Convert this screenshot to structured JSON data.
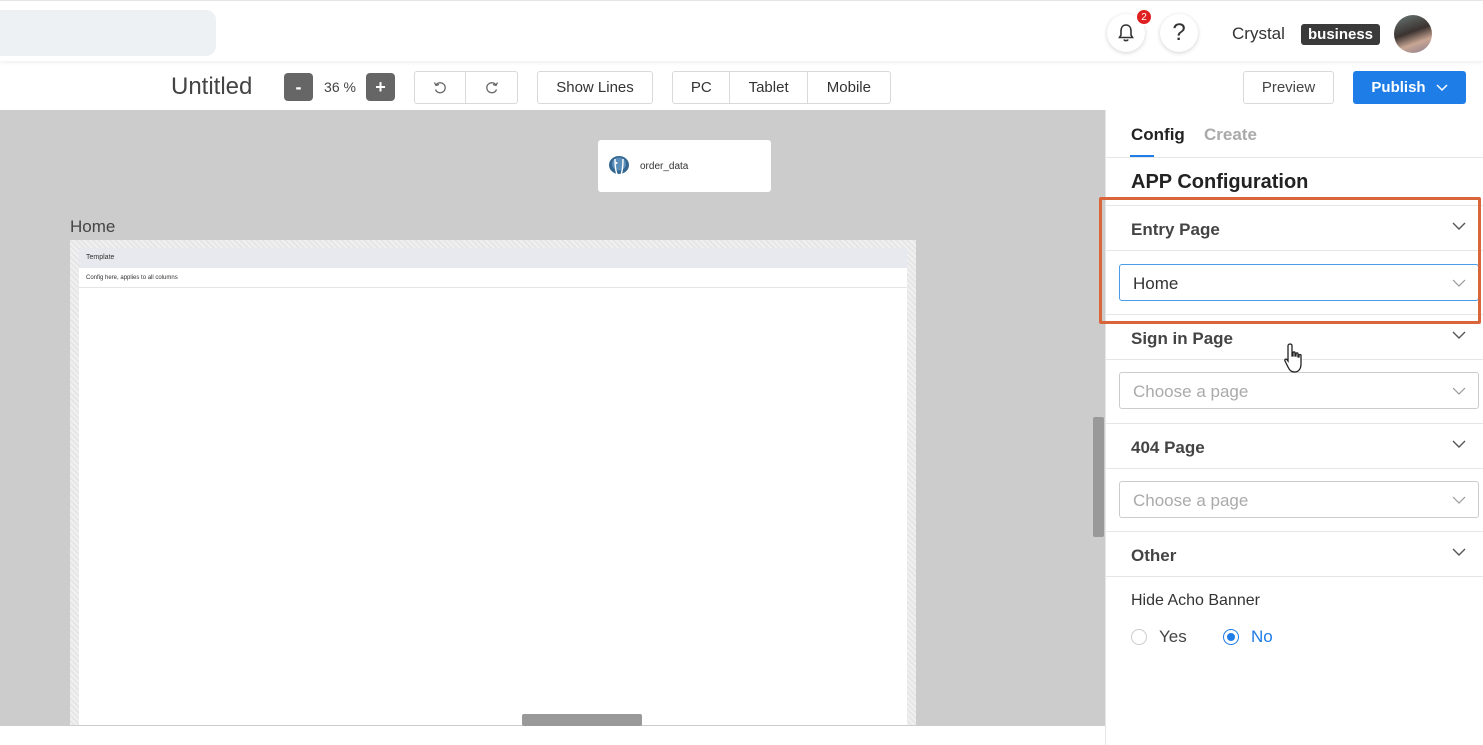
{
  "header": {
    "notification_count": "2",
    "help_glyph": "?",
    "username": "Crystal",
    "plan": "business"
  },
  "toolbar": {
    "title": "Untitled",
    "zoom_minus": "-",
    "zoom_value": "36 %",
    "zoom_plus": "+",
    "show_lines": "Show Lines",
    "devices": [
      "PC",
      "Tablet",
      "Mobile"
    ],
    "preview": "Preview",
    "publish": "Publish"
  },
  "canvas": {
    "datasource_name": "order_data",
    "page_name": "Home",
    "template_header": "Template",
    "template_row": "Config here, applies to all columns"
  },
  "panel": {
    "tabs": [
      "Config",
      "Create"
    ],
    "title": "APP Configuration",
    "sections": {
      "entry_page": {
        "label": "Entry Page",
        "value": "Home"
      },
      "sign_in_page": {
        "label": "Sign in Page",
        "placeholder": "Choose a page"
      },
      "not_found_page": {
        "label": "404 Page",
        "placeholder": "Choose a page"
      },
      "other": {
        "label": "Other"
      }
    },
    "hide_banner": {
      "label": "Hide Acho Banner",
      "options": [
        "Yes",
        "No"
      ],
      "selected": "No"
    }
  },
  "colors": {
    "accent": "#1e7de6",
    "highlight": "#d9653b",
    "badge": "#e02020"
  }
}
